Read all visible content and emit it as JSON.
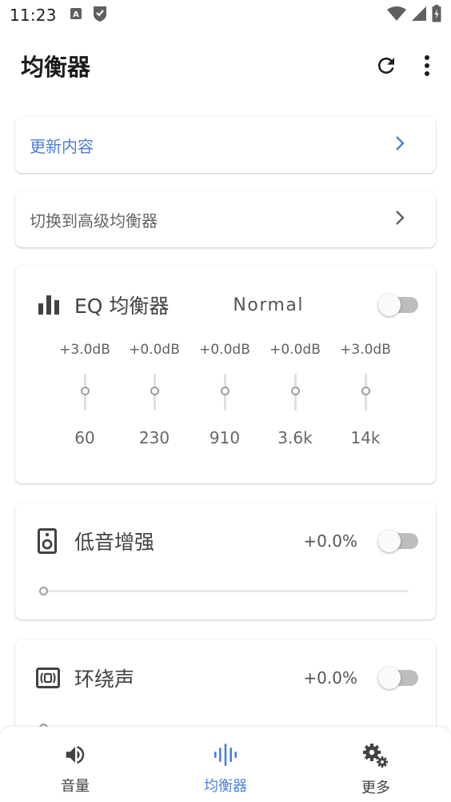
{
  "status_bar": {
    "time": "11:23",
    "icons": [
      "a-icon",
      "shield-check-icon",
      "wifi-icon",
      "signal-icon",
      "battery-icon"
    ]
  },
  "app_bar": {
    "title": "均衡器",
    "actions": [
      "refresh-icon",
      "more-vert-icon"
    ]
  },
  "links": {
    "update": {
      "label": "更新内容",
      "color": "#4e7fd9"
    },
    "advanced": {
      "label": "切换到高级均衡器",
      "color": "#666666"
    }
  },
  "eq": {
    "title": "EQ 均衡器",
    "preset": "Normal",
    "enabled": false,
    "bands": [
      {
        "gain": "+3.0dB",
        "freq": "60"
      },
      {
        "gain": "+0.0dB",
        "freq": "230"
      },
      {
        "gain": "+0.0dB",
        "freq": "910"
      },
      {
        "gain": "+0.0dB",
        "freq": "3.6k"
      },
      {
        "gain": "+3.0dB",
        "freq": "14k"
      }
    ]
  },
  "bass": {
    "title": "低音增强",
    "value": "+0.0%",
    "enabled": false,
    "level": 0
  },
  "surround": {
    "title": "环绕声",
    "value": "+0.0%",
    "enabled": false,
    "level": 0
  },
  "bottom_nav": {
    "items": [
      {
        "label": "音量",
        "icon": "volume-icon",
        "active": false
      },
      {
        "label": "均衡器",
        "icon": "equalizer-icon",
        "active": true
      },
      {
        "label": "更多",
        "icon": "settings-icon",
        "active": false
      }
    ],
    "active_color": "#4e7fd9",
    "inactive_color": "#424242"
  }
}
